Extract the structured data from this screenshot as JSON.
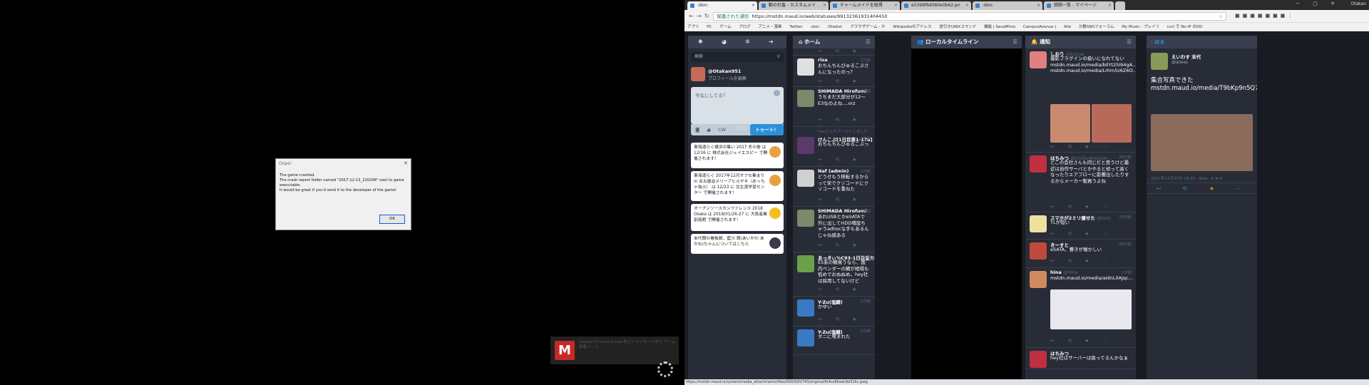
{
  "dialog": {
    "title": "Oops!",
    "line1": "The game crashed.",
    "line2": "The crash report folder named \"2017-12-13_220248\" next to game executable.",
    "line3": "It would be great if you'd send it to the developer of the game!",
    "ok": "OK"
  },
  "notification": {
    "text": "Google Chrome Gmail 新しいメッセージあり ゲーム 新着メール"
  },
  "browser": {
    "tabs": [
      {
        "label": ":don:"
      },
      {
        "label": "動の社畜 - カスタムメイ"
      },
      {
        "label": "チャームメイドを取得"
      },
      {
        "label": "e5399f6d080e0b62.pn"
      },
      {
        "label": ":don:"
      },
      {
        "label": "鉄腕一覧 - マイページ"
      }
    ],
    "user": "Otakan",
    "secure_label": "保護された通信",
    "url": "https://mstdn.maud.io/web/statuses/99132361931404450",
    "bookmarks": [
      "アプリ",
      "PC",
      "ゲーム",
      "ブログ",
      "アニメ・漫画",
      "Twitter",
      ":don:",
      "Otadon",
      "ブラウザゲーム - ホ",
      "Wikipediaのアドレス",
      "逆引きUNIXコマンド",
      "機能 | SavaMinis",
      "CampusAvenue |",
      "Allo",
      "分散SNSフォーラム",
      "My Music - プレイリ",
      "curl で No-IP のDD"
    ],
    "status_url": "https://mstdn.maud.io/system/media_attachments/files/000/920/743/original/fb4ce86adc9d316c.jpeg"
  },
  "drawer": {
    "search_placeholder": "検索",
    "username": "@Otakan951",
    "edit_profile": "プロフィールを編集",
    "compose_placeholder": "今なにしてる？",
    "cw": "CW",
    "counter": "500",
    "toot": "トゥート！",
    "announcements": [
      {
        "text": "東海道らぐ横浜の集い 2017 冬の巻 は 12/16 に 株式会社ジェイエスピー で開催されます！"
      },
      {
        "text": "東海道らぐ 2017年12月オフな集まり in 名古屋@メリーアヒルヤキ（めっちゃ強火） は 12/23 に 北生涯学習センター で開催されます！"
      },
      {
        "text": "オープンソースカンファレンス 2018 Osaka は 2018/01/26-27 に 大阪産業創造館 で開催されます！"
      },
      {
        "text": "末代闘の看板娘、藍川 茜(あいかわ あかね)ちゃんについてはこちら"
      }
    ]
  },
  "home": {
    "title": "ホーム",
    "statuses": [
      {
        "name": "risa",
        "handle": "@risa@kirishima.jp",
        "time": "1分前",
        "text": "おちんちんびゅるこぷさんになったのっ？"
      },
      {
        "name": "SHIMADA Hirofumi",
        "handle": "@shimada...",
        "time": "1分前",
        "text": "うちまだ大部分が12〜E3なのよね....orz"
      },
      {
        "boost": "risaさんがブーストしました",
        "name": "けんこぶ[1日目東1-17a]",
        "handle": "@k...",
        "time": "1分前",
        "text": "おちんちんびゅるこぷっ"
      },
      {
        "name": "Naf (admin)",
        "handle": "@Naf@otogame...",
        "time": "1分前",
        "text": "どうせもう移転するからって宋でクソコードにクソコードを重ねた"
      },
      {
        "name": "SHIMADA Hirofumi",
        "handle": "@shima...",
        "time": "1分前",
        "text": "あれUSBとかeSATAで外に出してHDD増設ちゃうadhocな手もあるんじゃね感ある"
      },
      {
        "name": "あっきぃ%C93-1日目金カ58",
        "handle": "",
        "time": "2分前",
        "text": "E5系の鯖買うなら、国内ベンダーの鯖が相場も低めでおぬぬめ。hey社は採用してないけど"
      },
      {
        "name": "Y-Zu(塩鯖)",
        "handle": "@Yotsu_Zuhu@m...",
        "time": "2分前",
        "text": "かゆい"
      },
      {
        "name": "Y-Zu(塩鯖)",
        "handle": "@Yotsu_Zuhu@m...",
        "time": "2分前",
        "text": "ダニに喰まれた"
      }
    ]
  },
  "local": {
    "title": "ローカルタイムライン"
  },
  "notifications": {
    "title": "通知",
    "statuses": [
      {
        "name": "しおり",
        "handle": "@kozue",
        "time": "",
        "text": "撮影プラグインの扱いになれてない mstdn.maud.io/media/bIlYt25I94gA... mstdn.maud.io/media/Lrhm5z6Z6O..."
      },
      {
        "name": "はちみつ",
        "handle": "@tmihu@mstdn...",
        "time": "28分前",
        "text": "どこの会社さんも同じだと思うけど最近は自作サーバとかやると却って高くなったりエアフローに影響出したりするからメーカー製買うよね"
      },
      {
        "name": "スマホが2ミリ痩せた",
        "handle": "@tom",
        "time": "30分前",
        "text": "TLが短い"
      },
      {
        "name": "きーすと",
        "handle": "",
        "time": "39分前",
        "text": "eSATA、響きが懐かしい"
      },
      {
        "name": "hina",
        "handle": "@hina",
        "time": "1分前",
        "text": "mstdn.maud.io/media/aIdnL0AJqc..."
      },
      {
        "name": "はちみつ",
        "handle": "@tmihu@mstdn.li...",
        "time": "1時間",
        "text": "hey社はサーバーは扱ってるんかなぁ"
      }
    ]
  },
  "detail": {
    "back": "戻る",
    "name": "えいわす",
    "name_suffix": "末代",
    "handle": "@aiwas",
    "text": "集合写真できた mstdn.maud.io/media/T9bKp9n5Q7...",
    "meta": "2017年12月07日 18:40 · Web · 8 ★ 4"
  }
}
